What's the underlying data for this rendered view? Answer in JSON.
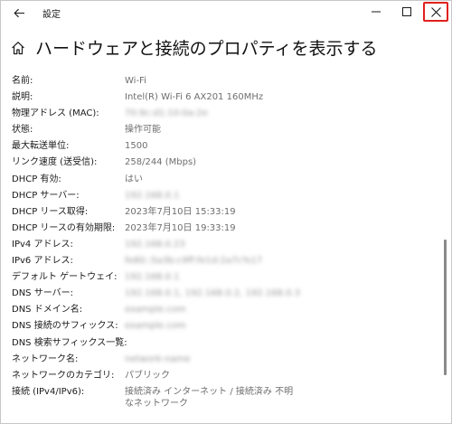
{
  "titlebar": {
    "app_title": "設定"
  },
  "header": {
    "title": "ハードウェアと接続のプロパティを表示する"
  },
  "properties": [
    {
      "label": "名前:",
      "value": "Wi-Fi"
    },
    {
      "label": "説明:",
      "value": "Intel(R) Wi-Fi 6 AX201 160MHz"
    },
    {
      "label": "物理アドレス (MAC):",
      "value": "70:9c:d1:10:0a:2e"
    },
    {
      "label": "状態:",
      "value": "操作可能"
    },
    {
      "label": "最大転送単位:",
      "value": "1500"
    },
    {
      "label": "リンク速度 (送受信):",
      "value": "258/244 (Mbps)"
    },
    {
      "label": "DHCP 有効:",
      "value": "はい"
    },
    {
      "label": "DHCP サーバー:",
      "value": "192.168.0.1"
    },
    {
      "label": "DHCP リース取得:",
      "value": "2023年7月10日 15:33:19"
    },
    {
      "label": "DHCP リースの有効期限:",
      "value": "2023年7月10日 19:33:19"
    },
    {
      "label": "IPv4 アドレス:",
      "value": "192.168.0.23"
    },
    {
      "label": "IPv6 アドレス:",
      "value": "fe80::5a3b:c9ff:fe1d:2a7c%17"
    },
    {
      "label": "デフォルト ゲートウェイ:",
      "value": "192.168.0.1"
    },
    {
      "label": "DNS サーバー:",
      "value": "192.168.0.1, 192.168.0.2, 192.168.0.3"
    },
    {
      "label": "DNS ドメイン名:",
      "value": "example.com"
    },
    {
      "label": "DNS 接続のサフィックス:",
      "value": "example.com"
    },
    {
      "label": "DNS 検索サフィックス一覧:",
      "value": ""
    },
    {
      "label": "ネットワーク名:",
      "value": "network-name"
    },
    {
      "label": "ネットワークのカテゴリ:",
      "value": "パブリック"
    },
    {
      "label": "接続 (IPv4/IPv6):",
      "value": "接続済み インターネット / 接続済み 不明なネットワーク"
    }
  ]
}
